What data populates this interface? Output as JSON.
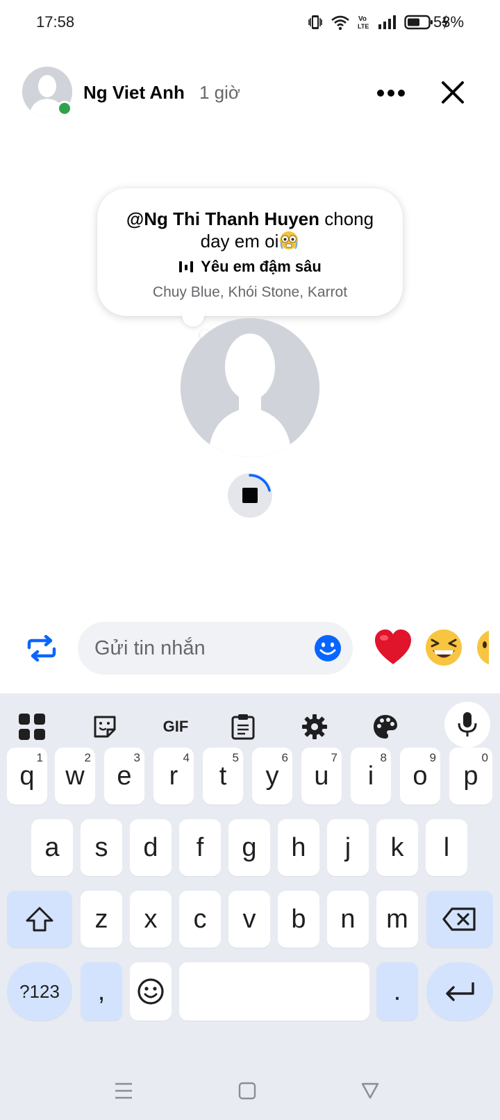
{
  "status_bar": {
    "time": "17:58",
    "battery": "53%",
    "icons": [
      "vibrate-icon",
      "wifi-icon",
      "volte-icon",
      "signal-icon",
      "battery-icon",
      "charging-icon"
    ],
    "volte_label_top": "Vo",
    "volte_label_bottom": "LTE"
  },
  "story": {
    "author": "Ng Viet Anh",
    "time_ago": "1 giờ",
    "online": true,
    "note": {
      "mention": "@Ng Thi Thanh Huyen",
      "text": " chong day em oi",
      "emoji": "flushed-face"
    },
    "song": {
      "title": "Yêu em đậm sâu",
      "artists": "Chuy Blue, Khói Stone, Karrot"
    }
  },
  "reply": {
    "placeholder": "Gửi tin nhắn",
    "reactions": [
      "heart",
      "laughing-face",
      "face"
    ]
  },
  "keyboard": {
    "toolbar": [
      "apps-icon",
      "sticker-icon",
      "GIF",
      "clipboard-icon",
      "settings-icon",
      "palette-icon",
      "mic-icon"
    ],
    "gif_label": "GIF",
    "row1": [
      {
        "key": "q",
        "hint": "1"
      },
      {
        "key": "w",
        "hint": "2"
      },
      {
        "key": "e",
        "hint": "3"
      },
      {
        "key": "r",
        "hint": "4"
      },
      {
        "key": "t",
        "hint": "5"
      },
      {
        "key": "y",
        "hint": "6"
      },
      {
        "key": "u",
        "hint": "7"
      },
      {
        "key": "i",
        "hint": "8"
      },
      {
        "key": "o",
        "hint": "9"
      },
      {
        "key": "p",
        "hint": "0"
      }
    ],
    "row2": [
      "a",
      "s",
      "d",
      "f",
      "g",
      "h",
      "j",
      "k",
      "l"
    ],
    "row3": [
      "z",
      "x",
      "c",
      "v",
      "b",
      "n",
      "m"
    ],
    "symbols_label": "?123",
    "comma": ",",
    "period": "."
  },
  "colors": {
    "accent": "#0866ff",
    "online": "#31a24c",
    "keyboard_bg": "#e8ebf1",
    "function_key": "#d3e3fd"
  }
}
